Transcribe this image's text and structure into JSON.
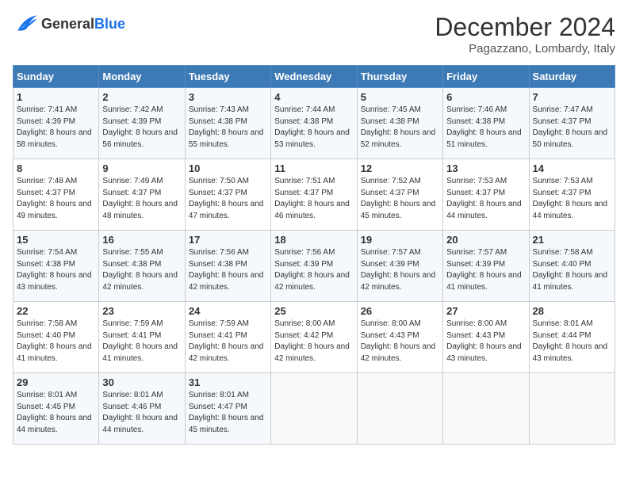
{
  "header": {
    "logo_general": "General",
    "logo_blue": "Blue",
    "month_title": "December 2024",
    "location": "Pagazzano, Lombardy, Italy"
  },
  "days_of_week": [
    "Sunday",
    "Monday",
    "Tuesday",
    "Wednesday",
    "Thursday",
    "Friday",
    "Saturday"
  ],
  "weeks": [
    [
      {
        "day": "1",
        "sunrise": "Sunrise: 7:41 AM",
        "sunset": "Sunset: 4:39 PM",
        "daylight": "Daylight: 8 hours and 58 minutes."
      },
      {
        "day": "2",
        "sunrise": "Sunrise: 7:42 AM",
        "sunset": "Sunset: 4:39 PM",
        "daylight": "Daylight: 8 hours and 56 minutes."
      },
      {
        "day": "3",
        "sunrise": "Sunrise: 7:43 AM",
        "sunset": "Sunset: 4:38 PM",
        "daylight": "Daylight: 8 hours and 55 minutes."
      },
      {
        "day": "4",
        "sunrise": "Sunrise: 7:44 AM",
        "sunset": "Sunset: 4:38 PM",
        "daylight": "Daylight: 8 hours and 53 minutes."
      },
      {
        "day": "5",
        "sunrise": "Sunrise: 7:45 AM",
        "sunset": "Sunset: 4:38 PM",
        "daylight": "Daylight: 8 hours and 52 minutes."
      },
      {
        "day": "6",
        "sunrise": "Sunrise: 7:46 AM",
        "sunset": "Sunset: 4:38 PM",
        "daylight": "Daylight: 8 hours and 51 minutes."
      },
      {
        "day": "7",
        "sunrise": "Sunrise: 7:47 AM",
        "sunset": "Sunset: 4:37 PM",
        "daylight": "Daylight: 8 hours and 50 minutes."
      }
    ],
    [
      {
        "day": "8",
        "sunrise": "Sunrise: 7:48 AM",
        "sunset": "Sunset: 4:37 PM",
        "daylight": "Daylight: 8 hours and 49 minutes."
      },
      {
        "day": "9",
        "sunrise": "Sunrise: 7:49 AM",
        "sunset": "Sunset: 4:37 PM",
        "daylight": "Daylight: 8 hours and 48 minutes."
      },
      {
        "day": "10",
        "sunrise": "Sunrise: 7:50 AM",
        "sunset": "Sunset: 4:37 PM",
        "daylight": "Daylight: 8 hours and 47 minutes."
      },
      {
        "day": "11",
        "sunrise": "Sunrise: 7:51 AM",
        "sunset": "Sunset: 4:37 PM",
        "daylight": "Daylight: 8 hours and 46 minutes."
      },
      {
        "day": "12",
        "sunrise": "Sunrise: 7:52 AM",
        "sunset": "Sunset: 4:37 PM",
        "daylight": "Daylight: 8 hours and 45 minutes."
      },
      {
        "day": "13",
        "sunrise": "Sunrise: 7:53 AM",
        "sunset": "Sunset: 4:37 PM",
        "daylight": "Daylight: 8 hours and 44 minutes."
      },
      {
        "day": "14",
        "sunrise": "Sunrise: 7:53 AM",
        "sunset": "Sunset: 4:37 PM",
        "daylight": "Daylight: 8 hours and 44 minutes."
      }
    ],
    [
      {
        "day": "15",
        "sunrise": "Sunrise: 7:54 AM",
        "sunset": "Sunset: 4:38 PM",
        "daylight": "Daylight: 8 hours and 43 minutes."
      },
      {
        "day": "16",
        "sunrise": "Sunrise: 7:55 AM",
        "sunset": "Sunset: 4:38 PM",
        "daylight": "Daylight: 8 hours and 42 minutes."
      },
      {
        "day": "17",
        "sunrise": "Sunrise: 7:56 AM",
        "sunset": "Sunset: 4:38 PM",
        "daylight": "Daylight: 8 hours and 42 minutes."
      },
      {
        "day": "18",
        "sunrise": "Sunrise: 7:56 AM",
        "sunset": "Sunset: 4:39 PM",
        "daylight": "Daylight: 8 hours and 42 minutes."
      },
      {
        "day": "19",
        "sunrise": "Sunrise: 7:57 AM",
        "sunset": "Sunset: 4:39 PM",
        "daylight": "Daylight: 8 hours and 42 minutes."
      },
      {
        "day": "20",
        "sunrise": "Sunrise: 7:57 AM",
        "sunset": "Sunset: 4:39 PM",
        "daylight": "Daylight: 8 hours and 41 minutes."
      },
      {
        "day": "21",
        "sunrise": "Sunrise: 7:58 AM",
        "sunset": "Sunset: 4:40 PM",
        "daylight": "Daylight: 8 hours and 41 minutes."
      }
    ],
    [
      {
        "day": "22",
        "sunrise": "Sunrise: 7:58 AM",
        "sunset": "Sunset: 4:40 PM",
        "daylight": "Daylight: 8 hours and 41 minutes."
      },
      {
        "day": "23",
        "sunrise": "Sunrise: 7:59 AM",
        "sunset": "Sunset: 4:41 PM",
        "daylight": "Daylight: 8 hours and 41 minutes."
      },
      {
        "day": "24",
        "sunrise": "Sunrise: 7:59 AM",
        "sunset": "Sunset: 4:41 PM",
        "daylight": "Daylight: 8 hours and 42 minutes."
      },
      {
        "day": "25",
        "sunrise": "Sunrise: 8:00 AM",
        "sunset": "Sunset: 4:42 PM",
        "daylight": "Daylight: 8 hours and 42 minutes."
      },
      {
        "day": "26",
        "sunrise": "Sunrise: 8:00 AM",
        "sunset": "Sunset: 4:43 PM",
        "daylight": "Daylight: 8 hours and 42 minutes."
      },
      {
        "day": "27",
        "sunrise": "Sunrise: 8:00 AM",
        "sunset": "Sunset: 4:43 PM",
        "daylight": "Daylight: 8 hours and 43 minutes."
      },
      {
        "day": "28",
        "sunrise": "Sunrise: 8:01 AM",
        "sunset": "Sunset: 4:44 PM",
        "daylight": "Daylight: 8 hours and 43 minutes."
      }
    ],
    [
      {
        "day": "29",
        "sunrise": "Sunrise: 8:01 AM",
        "sunset": "Sunset: 4:45 PM",
        "daylight": "Daylight: 8 hours and 44 minutes."
      },
      {
        "day": "30",
        "sunrise": "Sunrise: 8:01 AM",
        "sunset": "Sunset: 4:46 PM",
        "daylight": "Daylight: 8 hours and 44 minutes."
      },
      {
        "day": "31",
        "sunrise": "Sunrise: 8:01 AM",
        "sunset": "Sunset: 4:47 PM",
        "daylight": "Daylight: 8 hours and 45 minutes."
      },
      null,
      null,
      null,
      null
    ]
  ]
}
